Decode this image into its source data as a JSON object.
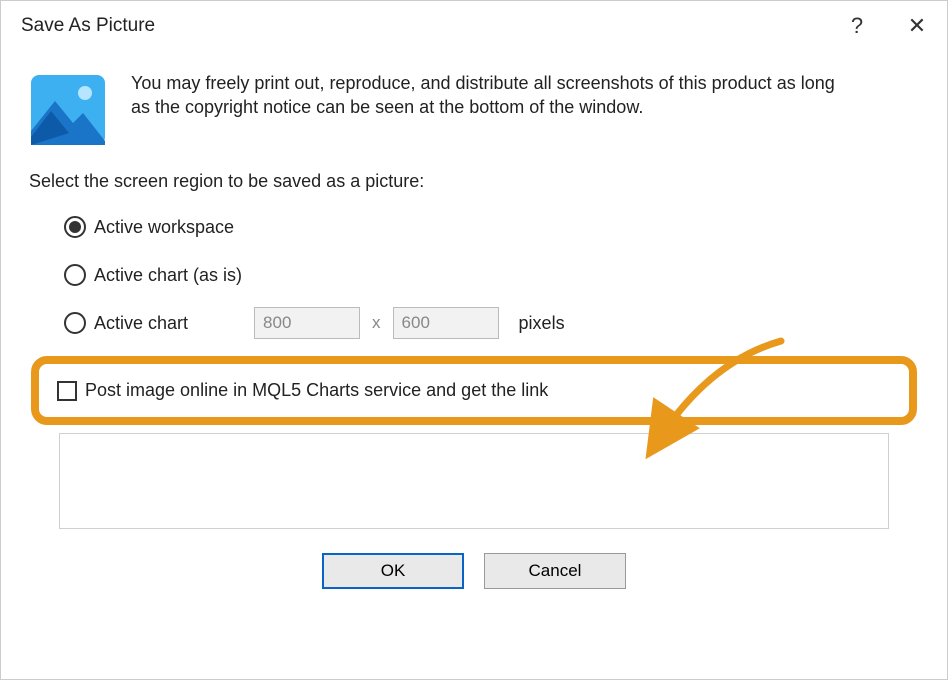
{
  "title": "Save As Picture",
  "intro_text": "You may freely print out, reproduce, and distribute all screenshots of this product as long as the copyright notice can be seen at the bottom of the window.",
  "select_label": "Select the screen region to be saved as a picture:",
  "radios": {
    "active_workspace": "Active workspace",
    "active_chart_asis": "Active chart (as is)",
    "active_chart": "Active chart"
  },
  "dimensions": {
    "width": "800",
    "height": "600",
    "separator": "x",
    "unit": "pixels"
  },
  "checkbox_label": "Post image online in MQL5 Charts service and get the link",
  "buttons": {
    "ok": "OK",
    "cancel": "Cancel"
  },
  "titlebar": {
    "help": "?",
    "close": "✕"
  }
}
